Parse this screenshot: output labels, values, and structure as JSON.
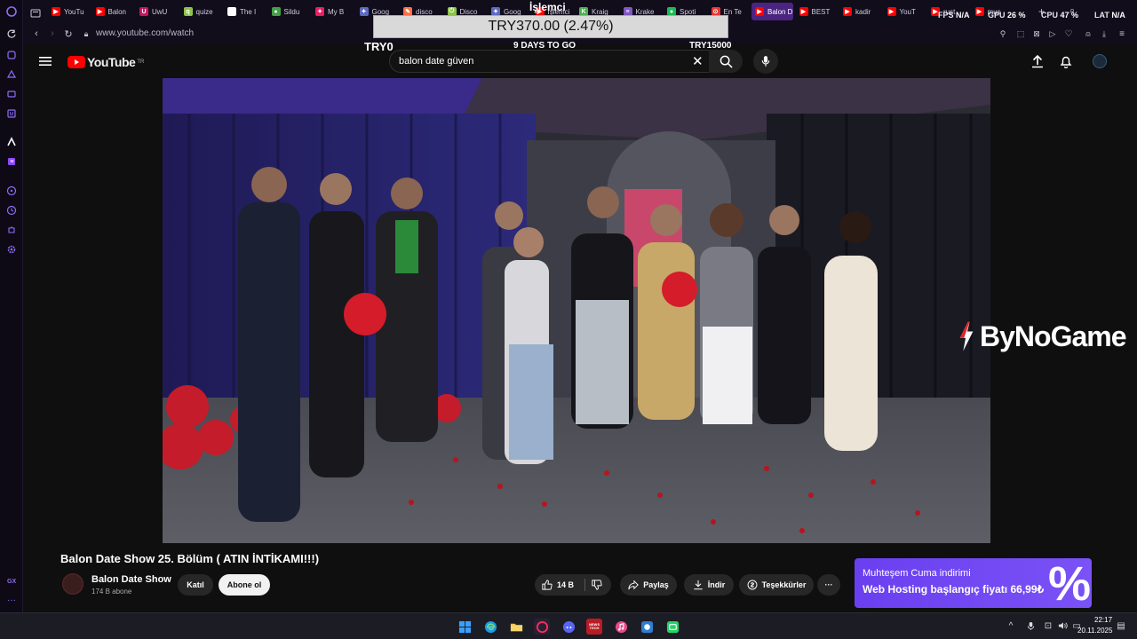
{
  "browser": {
    "url": "www.youtube.com/watch",
    "tabs": [
      {
        "label": "YouTu",
        "color": "#ff0000",
        "glyph": "▶"
      },
      {
        "label": "Balon",
        "color": "#ff0000",
        "glyph": "▶"
      },
      {
        "label": "UwU",
        "color": "#c2185b",
        "glyph": "U"
      },
      {
        "label": "quize",
        "color": "#8bc34a",
        "glyph": "q"
      },
      {
        "label": "The I",
        "color": "#ffffff",
        "glyph": "◆"
      },
      {
        "label": "Sildu",
        "color": "#43a047",
        "glyph": "●"
      },
      {
        "label": "My B",
        "color": "#e91e63",
        "glyph": "✦"
      },
      {
        "label": "Goog",
        "color": "#5c6bc0",
        "glyph": "✦"
      },
      {
        "label": "disco",
        "color": "#ff7043",
        "glyph": "✎"
      },
      {
        "label": "Disco",
        "color": "#8bc34a",
        "glyph": "⏻"
      },
      {
        "label": "Goog",
        "color": "#5c6bc0",
        "glyph": "✦"
      },
      {
        "label": "İşlemci",
        "color": "#ff0000",
        "glyph": "▶"
      },
      {
        "label": "Kraig",
        "color": "#4caf50",
        "glyph": "K"
      },
      {
        "label": "Krake",
        "color": "#7e57c2",
        "glyph": "≡"
      },
      {
        "label": "Spoti",
        "color": "#1db954",
        "glyph": "●"
      },
      {
        "label": "En Te",
        "color": "#e53935",
        "glyph": "⊙"
      },
      {
        "label": "Balon D",
        "color": "#ff0000",
        "glyph": "▶"
      },
      {
        "label": "BEST",
        "color": "#ff0000",
        "glyph": "▶"
      },
      {
        "label": "kadir",
        "color": "#ff0000",
        "glyph": "▶"
      },
      {
        "label": "YouT",
        "color": "#ff0000",
        "glyph": "▶"
      },
      {
        "label": "rust",
        "color": "#ff0000",
        "glyph": "▶"
      },
      {
        "label": "mus",
        "color": "#ff0000",
        "glyph": "▶"
      }
    ],
    "hw": {
      "fps_label": "FPS",
      "fps_value": "N/A",
      "gpu_label": "GPU",
      "gpu_value": "26 %",
      "cpu_label": "CPU",
      "cpu_value": "47 %",
      "lat_label": "LAT",
      "lat_value": "N/A"
    }
  },
  "overlay": {
    "islemci": "İşlemci",
    "donation_amount": "TRY370.00 (2.47%)",
    "goal_start": "TRY0",
    "goal_days": "9 DAYS TO GO",
    "goal_end": "TRY15000",
    "bynogame": "ByNoGame"
  },
  "youtube": {
    "logo_text": "YouTube",
    "region": "TR",
    "search_value": "balon date güven",
    "video_title": "Balon Date Show 25. Bölüm ( ATIN İNTİKAMI!!!)",
    "channel_name": "Balon Date Show",
    "channel_subs": "174 B abone",
    "join_label": "Katıl",
    "subscribe_label": "Abone ol",
    "like_count": "14 B",
    "share_label": "Paylaş",
    "download_label": "İndir",
    "thanks_label": "Teşekkürler",
    "more_label": "···"
  },
  "ad": {
    "line1": "Muhteşem Cuma indirimi",
    "line2": "Web Hosting başlangıç fiyatı 66,99₺",
    "pct": "%"
  },
  "taskbar": {
    "time": "22:17",
    "date": "20.11.2025",
    "news_label": "NEWS\nTECH"
  },
  "colors": {
    "accent_gx": "#6c3fd6",
    "yt_red": "#ff0000",
    "ad_purple": "#7a52f6"
  }
}
